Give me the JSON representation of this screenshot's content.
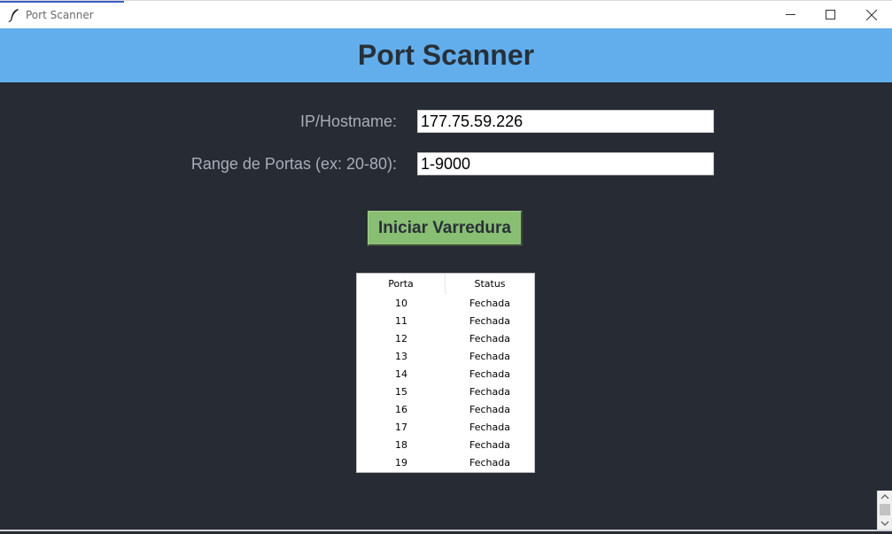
{
  "window": {
    "title": "Port Scanner",
    "controls": {
      "minimize": "minimize-icon",
      "maximize": "maximize-icon",
      "close": "close-icon"
    }
  },
  "header": {
    "title": "Port Scanner"
  },
  "form": {
    "ip_label": "IP/Hostname:",
    "ip_value": "177.75.59.226",
    "range_label": "Range de Portas (ex: 20-80):",
    "range_value": "1-9000",
    "scan_button": "Iniciar Varredura"
  },
  "table": {
    "columns": [
      "Porta",
      "Status"
    ],
    "rows": [
      {
        "porta": "10",
        "status": "Fechada"
      },
      {
        "porta": "11",
        "status": "Fechada"
      },
      {
        "porta": "12",
        "status": "Fechada"
      },
      {
        "porta": "13",
        "status": "Fechada"
      },
      {
        "porta": "14",
        "status": "Fechada"
      },
      {
        "porta": "15",
        "status": "Fechada"
      },
      {
        "porta": "16",
        "status": "Fechada"
      },
      {
        "porta": "17",
        "status": "Fechada"
      },
      {
        "porta": "18",
        "status": "Fechada"
      },
      {
        "porta": "19",
        "status": "Fechada"
      }
    ]
  },
  "colors": {
    "background": "#272b33",
    "header": "#62aeec",
    "button": "#89bf72",
    "title_text": "#283038",
    "label_text": "#a8aeb8"
  }
}
